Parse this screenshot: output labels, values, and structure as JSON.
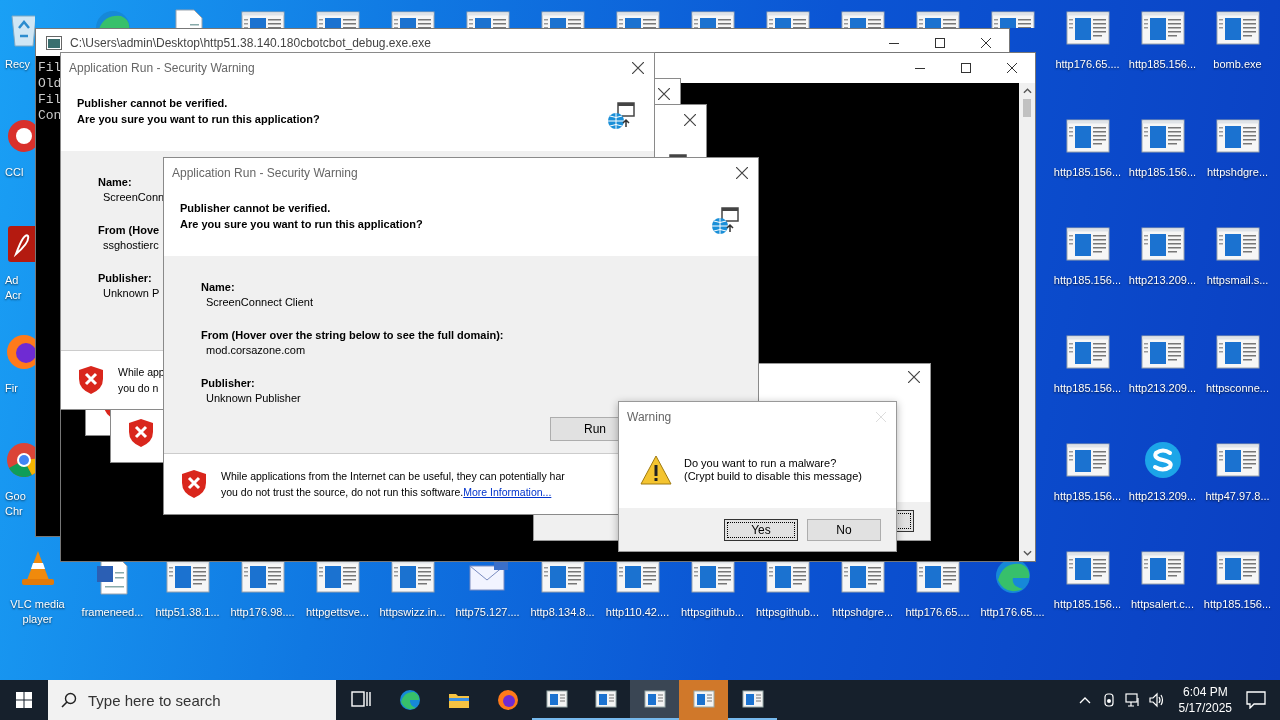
{
  "desktop": {
    "left_column": [
      {
        "kind": "recycle",
        "label": "Recy"
      },
      {
        "kind": "ccleaner",
        "label": "CCl"
      },
      {
        "kind": "acrobat",
        "label": "Ad Acr"
      },
      {
        "kind": "firefox",
        "label": "Fir"
      },
      {
        "kind": "chrome",
        "label": "Goo Chr"
      },
      {
        "kind": "vlc",
        "label": "VLC media player"
      }
    ],
    "top_row": [
      {
        "kind": "edge"
      },
      {
        "kind": "document"
      },
      {
        "kind": "program"
      },
      {
        "kind": "program"
      },
      {
        "kind": "program"
      },
      {
        "kind": "program"
      },
      {
        "kind": "program"
      },
      {
        "kind": "program"
      },
      {
        "kind": "program"
      },
      {
        "kind": "program"
      },
      {
        "kind": "program"
      },
      {
        "kind": "program"
      },
      {
        "kind": "program"
      }
    ],
    "bottom_row": [
      {
        "kind": "word",
        "label": "frameneed..."
      },
      {
        "kind": "program",
        "label": "http51.38.1..."
      },
      {
        "kind": "program",
        "label": "http176.98...."
      },
      {
        "kind": "program",
        "label": "httpgettsve..."
      },
      {
        "kind": "program",
        "label": "httpswizz.in..."
      },
      {
        "kind": "mail",
        "label": "http75.127...."
      },
      {
        "kind": "program",
        "label": "http8.134.8..."
      },
      {
        "kind": "program",
        "label": "http110.42...."
      },
      {
        "kind": "program",
        "label": "httpsgithub..."
      },
      {
        "kind": "program",
        "label": "httpsgithub..."
      },
      {
        "kind": "program",
        "label": "httpshdgre..."
      },
      {
        "kind": "program",
        "label": "http176.65...."
      },
      {
        "kind": "edge",
        "label": "http176.65...."
      }
    ],
    "right_columns": [
      [
        {
          "kind": "program",
          "label": "http176.65...."
        },
        {
          "kind": "program",
          "label": "http185.156..."
        },
        {
          "kind": "program",
          "label": "http185.156..."
        },
        {
          "kind": "program",
          "label": "http185.156..."
        },
        {
          "kind": "program",
          "label": "http185.156..."
        },
        {
          "kind": "program",
          "label": "http185.156..."
        }
      ],
      [
        {
          "kind": "program",
          "label": "http185.156..."
        },
        {
          "kind": "program",
          "label": "http185.156..."
        },
        {
          "kind": "program",
          "label": "http213.209..."
        },
        {
          "kind": "program",
          "label": "http213.209..."
        },
        {
          "kind": "skype",
          "label": "http213.209..."
        },
        {
          "kind": "program",
          "label": "httpsalert.c..."
        }
      ],
      [
        {
          "kind": "program",
          "label": "bomb.exe"
        },
        {
          "kind": "program",
          "label": "httpshdgre..."
        },
        {
          "kind": "program",
          "label": "httpsmail.s..."
        },
        {
          "kind": "program",
          "label": "httpsconne..."
        },
        {
          "kind": "program",
          "label": "http47.97.8..."
        },
        {
          "kind": "program",
          "label": "http185.156..."
        }
      ]
    ]
  },
  "console_window": {
    "title": "C:\\Users\\admin\\Desktop\\http51.38.140.180cbotcbot_debug.exe.exe",
    "lines": [
      "Fil",
      "Old",
      "Fil",
      "Con"
    ]
  },
  "security_dialogs": [
    {
      "title": "Application Run - Security Warning",
      "headline": "Publisher cannot be verified.",
      "question": "Are you sure you want to run this application?",
      "fields": [
        {
          "label": "Name:",
          "value": "ScreenConn"
        },
        {
          "label": "From (Hove",
          "value": "ssghostierc"
        },
        {
          "label": "Publisher:",
          "value": "Unknown P"
        }
      ],
      "footer_lines": [
        "While app",
        "you do n"
      ]
    },
    {
      "title": "Application Run - Security Warning",
      "headline": "Publisher cannot be verified.",
      "question": "Are you sure you want to run this application?",
      "fields": [
        {
          "label": "Name:",
          "value": "ScreenConnect Client"
        },
        {
          "label": "From (Hover over the string below to see the full domain):",
          "value": "mod.corsazone.com"
        },
        {
          "label": "Publisher:",
          "value": "Unknown Publisher"
        }
      ],
      "run_button": "Run",
      "footer_lines": [
        "While applications from the Internet can be useful, they can potentially har",
        "you do not trust the source, do not run this software."
      ],
      "footer_link": "More Information..."
    }
  ],
  "warning_dialog": {
    "title": "Warning",
    "message_lines": [
      "Do you want to run a malware?",
      "(Crypt build to disable this message)"
    ],
    "buttons": [
      {
        "label": "Yes",
        "focused": true
      },
      {
        "label": "No",
        "focused": false
      }
    ]
  },
  "taskbar": {
    "search_placeholder": "Type here to search",
    "apps": [
      {
        "kind": "taskview",
        "running": false,
        "selected": false,
        "flashing": false
      },
      {
        "kind": "edge",
        "running": false,
        "selected": false,
        "flashing": false
      },
      {
        "kind": "folder",
        "running": false,
        "selected": false,
        "flashing": false
      },
      {
        "kind": "firefox",
        "running": false,
        "selected": false,
        "flashing": false
      },
      {
        "kind": "program",
        "running": true,
        "selected": false,
        "flashing": false
      },
      {
        "kind": "program",
        "running": true,
        "selected": false,
        "flashing": false
      },
      {
        "kind": "program",
        "running": true,
        "selected": true,
        "flashing": false
      },
      {
        "kind": "program",
        "running": true,
        "selected": false,
        "flashing": true
      },
      {
        "kind": "program",
        "running": true,
        "selected": false,
        "flashing": false
      }
    ],
    "time": "6:04 PM",
    "date": "5/17/2025"
  }
}
